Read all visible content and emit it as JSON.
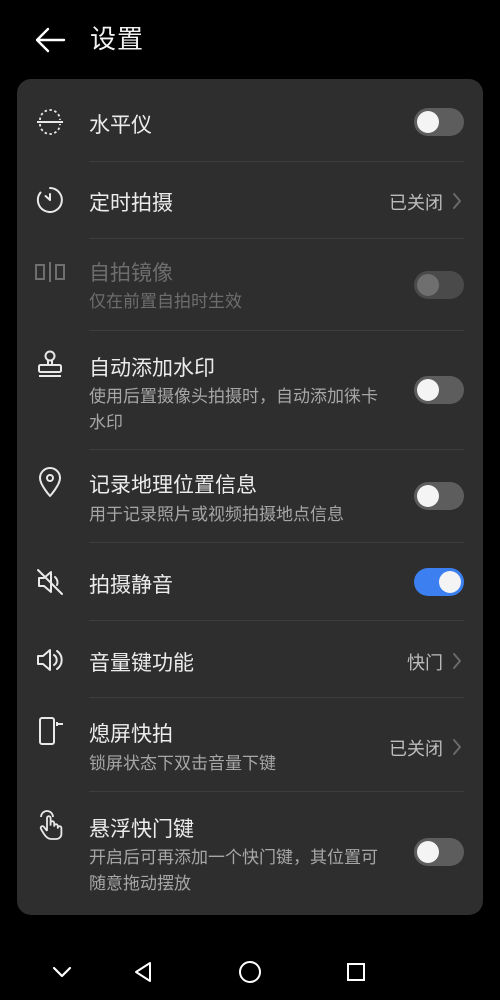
{
  "header": {
    "title": "设置"
  },
  "settings": {
    "level": {
      "title": "水平仪",
      "toggle": "off"
    },
    "timer": {
      "title": "定时拍摄",
      "value": "已关闭"
    },
    "selfie_mirror": {
      "title": "自拍镜像",
      "subtitle": "仅在前置自拍时生效",
      "toggle": "off-disabled"
    },
    "watermark": {
      "title": "自动添加水印",
      "subtitle": "使用后置摄像头拍摄时，自动添加徕卡水印",
      "toggle": "off"
    },
    "location": {
      "title": "记录地理位置信息",
      "subtitle": "用于记录照片或视频拍摄地点信息",
      "toggle": "off"
    },
    "mute": {
      "title": "拍摄静音",
      "toggle": "on"
    },
    "volume_key": {
      "title": "音量键功能",
      "value": "快门"
    },
    "screen_off_snap": {
      "title": "熄屏快拍",
      "subtitle": "锁屏状态下双击音量下键",
      "value": "已关闭"
    },
    "floating_shutter": {
      "title": "悬浮快门键",
      "subtitle": "开启后可再添加一个快门键，其位置可随意拖动摆放",
      "toggle": "off"
    }
  },
  "colors": {
    "accent": "#3b7ff0",
    "card": "#2e2e2e",
    "background": "#000000"
  },
  "navbar": {
    "icons": [
      "chevron-down-icon",
      "back-triangle-icon",
      "home-circle-icon",
      "recents-square-icon"
    ]
  }
}
